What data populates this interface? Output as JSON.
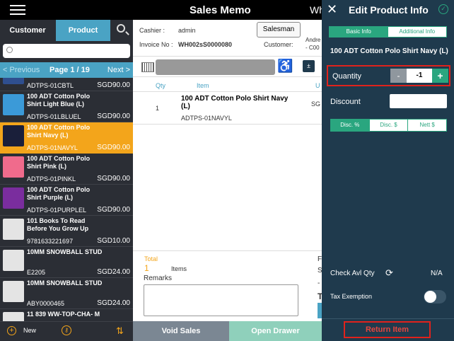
{
  "header": {
    "title": "Sales Memo",
    "right_text": "Wh"
  },
  "left": {
    "tabs": {
      "customer": "Customer",
      "product": "Product"
    },
    "search": {
      "placeholder": ""
    },
    "pager": {
      "prev": "< Previous",
      "page": "Page 1 / 19",
      "next": "Next >"
    },
    "products": [
      {
        "name": "",
        "code": "ADTPS-01CBTL",
        "price": "SGD90.00"
      },
      {
        "name": "100 ADT Cotton Polo Shirt Light Blue (L)",
        "code": "ADTPS-01LBLUEL",
        "price": "SGD90.00"
      },
      {
        "name": "100 ADT Cotton Polo Shirt Navy (L)",
        "code": "ADTPS-01NAVYL",
        "price": "SGD90.00"
      },
      {
        "name": "100 ADT Cotton Polo Shirt Pink (L)",
        "code": "ADTPS-01PINKL",
        "price": "SGD90.00"
      },
      {
        "name": "100 ADT Cotton Polo Shirt Purple (L)",
        "code": "ADTPS-01PURPLEL",
        "price": "SGD90.00"
      },
      {
        "name": "101 Books To Read Before You Grow Up",
        "code": "9781633221697",
        "price": "SGD10.00"
      },
      {
        "name": "10MM SNOWBALL STUD",
        "code": "E2205",
        "price": "SGD24.00"
      },
      {
        "name": "10MM SNOWBALL STUD",
        "code": "ABY0000465",
        "price": "SGD24.00"
      },
      {
        "name": "11 839 WW-TOP-CHA- M",
        "code": "",
        "price": ""
      }
    ],
    "colors": {
      "thumb_light_blue": "#3b9ad8",
      "thumb_navy": "#1a1f3a",
      "thumb_pink": "#f06b8c",
      "thumb_purple": "#7a2d9e",
      "thumb_placeholder": "#e4e4e4",
      "selected": "#f3a51b"
    },
    "footer": {
      "new_label": "New"
    }
  },
  "middle": {
    "cashier_label": "Cashier :",
    "cashier_value": "admin",
    "invoice_label": "Invoice No :",
    "invoice_value": "WH002sS0000080",
    "customer_label": "Customer:",
    "customer_value_1": "Andre",
    "customer_value_2": "- C00",
    "salesman_button": "Salesman",
    "table_headers": {
      "qty": "Qty",
      "item": "Item",
      "u": "U"
    },
    "line_item": {
      "qty": "1",
      "name": "100 ADT Cotton Polo Shirt Navy (L)",
      "code": "ADTPS-01NAVYL",
      "price_partial": "SG"
    },
    "total_label": "Total",
    "total_value": "1",
    "items_label": "Items",
    "remarks_label": "Remarks",
    "col_f": "F",
    "col_s": "S",
    "col_dash": "-",
    "col_t": "T",
    "void_sales": "Void Sales",
    "open_drawer": "Open Drawer"
  },
  "right": {
    "title": "Edit Product Info",
    "tabs": {
      "basic": "Basic Info",
      "additional": "Additional Info"
    },
    "product_title": "100 ADT Cotton Polo Shirt Navy (L)",
    "quantity_label": "Quantity",
    "quantity_value": "-1",
    "minus": "-",
    "plus": "+",
    "discount_label": "Discount",
    "discount_value": "",
    "discount_types": [
      "Disc. %",
      "Disc. $",
      "Nett $"
    ],
    "check_avl_qty": "Check Avl Qty",
    "avl_value": "N/A",
    "tax_exemption": "Tax Exemption",
    "return_item": "Return Item",
    "colors": {
      "accent": "#2aa67f",
      "highlight": "#e0221c",
      "panel": "#1f3a4d"
    }
  }
}
